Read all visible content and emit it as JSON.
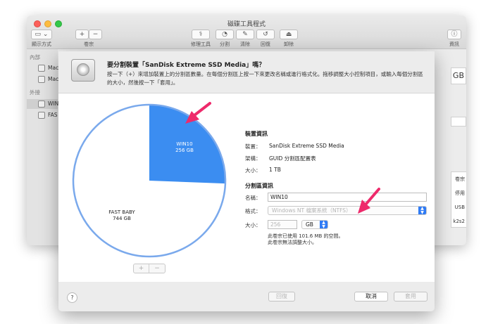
{
  "window": {
    "title": "磁碟工具程式",
    "toolbar": {
      "view_label": "顯示方式",
      "volume_label": "卷宗",
      "plus": "+",
      "minus": "−",
      "firstaid_label": "修理工具",
      "partition_label": "分割",
      "erase_label": "清除",
      "restore_label": "回復",
      "unmount_label": "卸除",
      "info_label": "資訊"
    },
    "sidebar": {
      "internal_header": "內部",
      "external_header": "外接",
      "items": [
        {
          "label": "Mac"
        },
        {
          "label": "Mac"
        },
        {
          "label": "WIN"
        },
        {
          "label": "FAS"
        }
      ]
    },
    "right_panel": {
      "size_fragment": "GB",
      "rows": [
        "卷宗",
        "停用",
        "USB",
        "k2s2"
      ]
    }
  },
  "sheet": {
    "title": "要分割裝置「SanDisk Extreme SSD Media」嗎？",
    "description": "按一下（+）來增加裝置上的分割區數量。在每個分割區上按一下來更改名稱或進行格式化。拖移調整大小控制項目，或輸入每個分割區的大小，然後按一下「套用」。",
    "pie": {
      "win_name": "WIN10",
      "win_size": "256 GB",
      "fast_name": "FAST BABY",
      "fast_size": "744 GB",
      "win_fraction": 0.256,
      "win_color": "#3b8df1",
      "fast_color": "#ffffff",
      "plus": "+",
      "minus": "−"
    },
    "device_info": {
      "header": "裝置資訊",
      "device_label": "裝置：",
      "device_value": "SanDisk Extreme SSD Media",
      "scheme_label": "架構：",
      "scheme_value": "GUID 分割區配置表",
      "size_label": "大小：",
      "size_value": "1 TB"
    },
    "partition_info": {
      "header": "分割區資訊",
      "name_label": "名稱：",
      "name_value": "WIN10",
      "format_label": "格式：",
      "format_value": "Windows NT 檔案系統（NTFS）",
      "size_label": "大小：",
      "size_value": "256",
      "unit_value": "GB",
      "note_line1": "此卷宗已使用 101.6 MB 的空間。",
      "note_line2": "此卷宗無法調整大小。"
    },
    "footer": {
      "help": "?",
      "revert": "回復",
      "cancel": "取消",
      "apply": "套用"
    },
    "accent_color": "#ee2a6b"
  }
}
